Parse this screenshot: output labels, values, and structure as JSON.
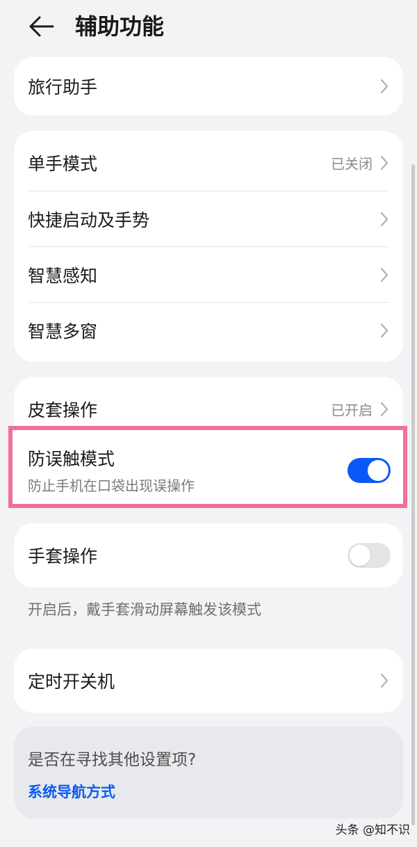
{
  "header": {
    "title": "辅助功能",
    "back_icon": "arrow-left-icon"
  },
  "travel": {
    "label": "旅行助手"
  },
  "group1": {
    "items": [
      {
        "label": "单手模式",
        "value": "已关闭"
      },
      {
        "label": "快捷启动及手势",
        "value": ""
      },
      {
        "label": "智慧感知",
        "value": ""
      },
      {
        "label": "智慧多窗",
        "value": ""
      }
    ]
  },
  "group2": {
    "cover": {
      "label": "皮套操作",
      "value": "已开启"
    },
    "mistouch": {
      "label": "防误触模式",
      "description": "防止手机在口袋出现误操作",
      "enabled": true
    }
  },
  "gloves": {
    "label": "手套操作",
    "enabled": false,
    "note": "开启后，戴手套滑动屏幕触发该模式"
  },
  "timer": {
    "label": "定时开关机"
  },
  "search": {
    "title": "是否在寻找其他设置项?",
    "link": "系统导航方式"
  },
  "watermark": "头条 @知不识",
  "colors": {
    "accent": "#0a59f7",
    "highlight": "#f0709a",
    "background": "#f1f3f5"
  }
}
